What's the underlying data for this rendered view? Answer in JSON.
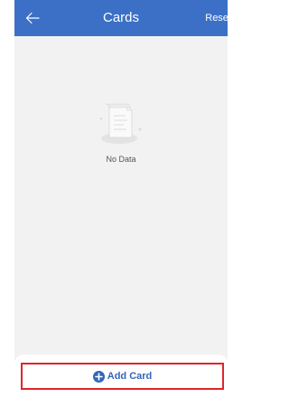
{
  "header": {
    "back_icon": "arrow-left-icon",
    "title": "Cards",
    "reset_label": "Reset"
  },
  "empty_state": {
    "illustration": "document-icon",
    "message": "No Data"
  },
  "footer": {
    "add_icon": "plus-circle-icon",
    "add_card_label": "Add Card"
  },
  "colors": {
    "header_bg": "#3b70c6",
    "page_bg": "#f2f2f2",
    "accent": "#3466b8",
    "highlight_border": "#e0252b"
  }
}
